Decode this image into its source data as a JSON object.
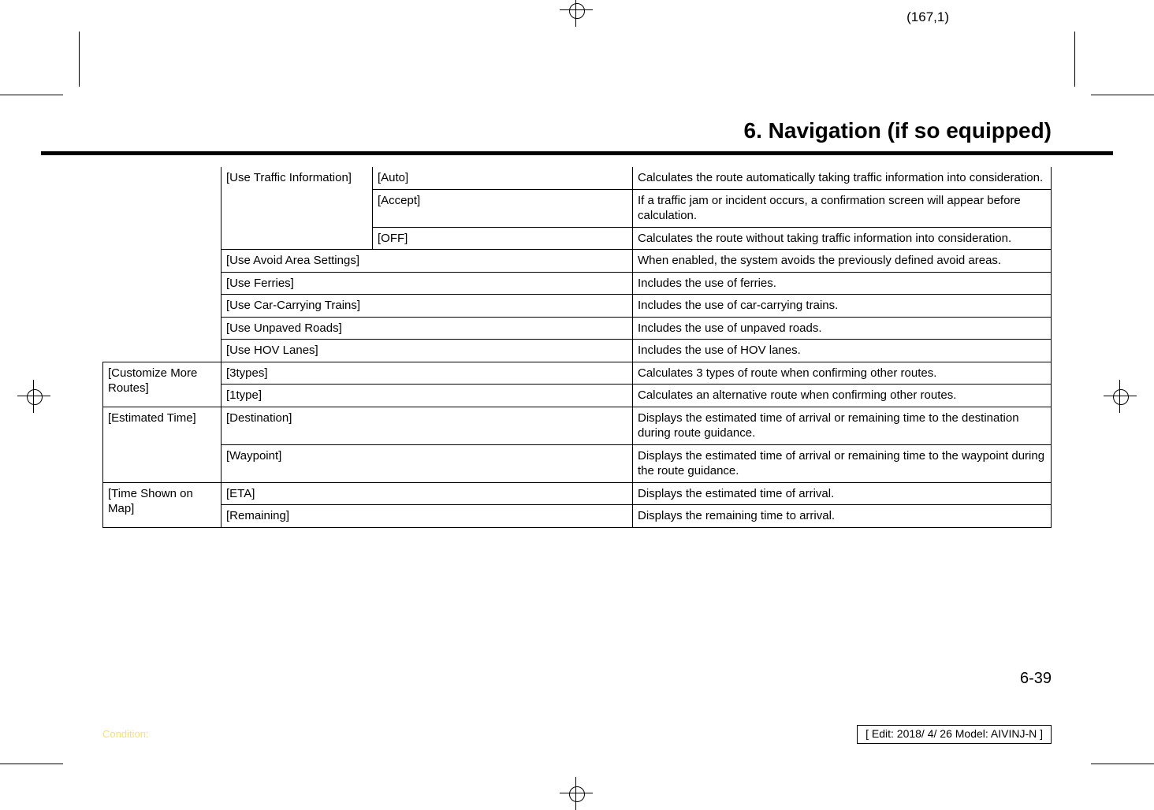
{
  "coord": "(167,1)",
  "chapter_title": "6. Navigation (if so equipped)",
  "page_number": "6-39",
  "condition_label": "Condition:",
  "footer_text": "[ Edit: 2018/ 4/ 26    Model: AIVINJ-N ]",
  "cells": {
    "traffic_label": "[Use Traffic Information]",
    "traffic_auto": "[Auto]",
    "traffic_auto_desc": "Calculates the route automatically taking traffic information into consideration.",
    "traffic_accept": "[Accept]",
    "traffic_accept_desc": "If a traffic jam or incident occurs, a confirmation screen will appear before calculation.",
    "traffic_off": "[OFF]",
    "traffic_off_desc": "Calculates the route without taking traffic information into consideration.",
    "avoid_label": "[Use Avoid Area Settings]",
    "avoid_desc": "When enabled, the system avoids the previously defined avoid areas.",
    "ferries_label": "[Use Ferries]",
    "ferries_desc": "Includes the use of ferries.",
    "trains_label": "[Use Car-Carrying Trains]",
    "trains_desc": "Includes the use of car-carrying trains.",
    "unpaved_label": "[Use Unpaved Roads]",
    "unpaved_desc": "Includes the use of unpaved roads.",
    "hov_label": "[Use HOV Lanes]",
    "hov_desc": "Includes the use of HOV lanes.",
    "customize_label": "[Customize More Routes]",
    "customize_3types": "[3types]",
    "customize_3types_desc": "Calculates 3 types of route when confirming other routes.",
    "customize_1type": "[1type]",
    "customize_1type_desc": "Calculates an alternative route when confirming other routes.",
    "est_label": "[Estimated Time]",
    "est_dest": "[Destination]",
    "est_dest_desc": "Displays the estimated time of arrival or remaining time to the destination during route guidance.",
    "est_wp": "[Waypoint]",
    "est_wp_desc": "Displays the estimated time of arrival or remaining time to the waypoint during the route guidance.",
    "time_label": "[Time Shown on Map]",
    "time_eta": "[ETA]",
    "time_eta_desc": "Displays the estimated time of arrival.",
    "time_remain": "[Remaining]",
    "time_remain_desc": "Displays the remaining time to arrival."
  }
}
